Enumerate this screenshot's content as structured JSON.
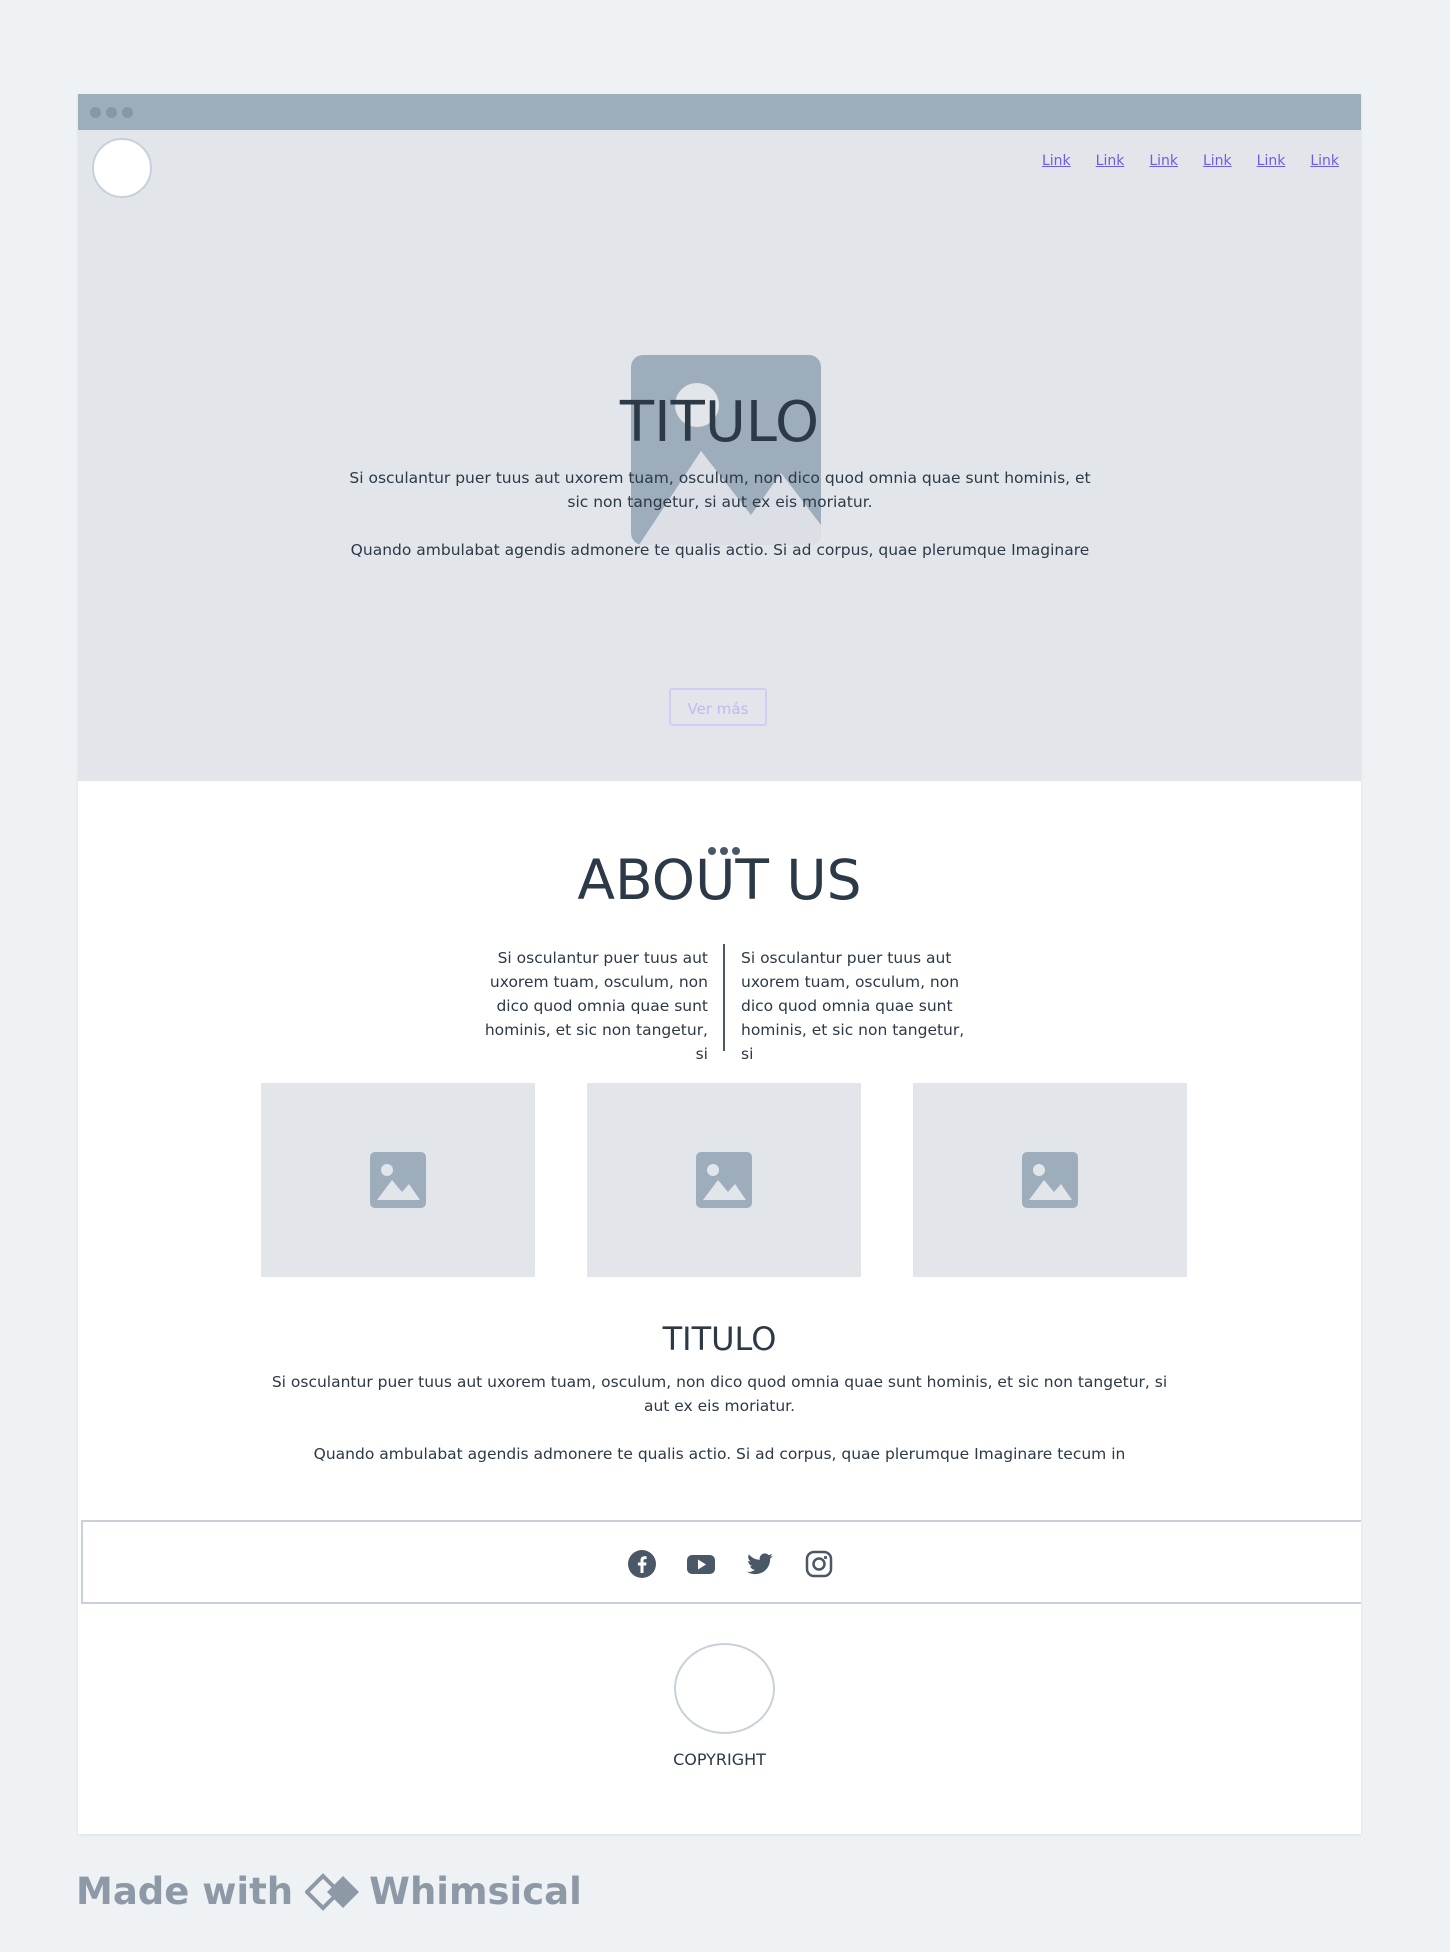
{
  "nav": {
    "links": [
      "Link",
      "Link",
      "Link",
      "Link",
      "Link",
      "Link"
    ]
  },
  "hero": {
    "title": "TITULO",
    "paragraph1": "Si osculantur puer tuus aut uxorem tuam, osculum, non dico quod omnia quae sunt hominis, et sic non tangetur, si aut ex eis moriatur.",
    "paragraph2": "Quando ambulabat agendis admonere te qualis actio. Si ad corpus, quae plerumque Imaginare",
    "button_label": "Ver más",
    "image_icon": "image-icon"
  },
  "about": {
    "title": "ABOUT US",
    "left_text": "Si osculantur puer tuus aut uxorem tuam, osculum, non dico quod omnia quae sunt hominis, et sic non tangetur, si",
    "right_text": "Si osculantur puer tuus aut uxorem tuam, osculum, non dico quod omnia quae sunt hominis, et sic non tangetur, si",
    "cards": [
      "image-icon",
      "image-icon",
      "image-icon"
    ]
  },
  "section": {
    "title": "TITULO",
    "paragraph1": "Si osculantur puer tuus aut uxorem tuam, osculum, non dico quod omnia quae sunt hominis, et sic non tangetur, si aut ex eis moriatur.",
    "paragraph2": "Quando ambulabat agendis admonere te qualis actio. Si ad corpus, quae plerumque Imaginare tecum in"
  },
  "social": [
    "facebook-icon",
    "youtube-icon",
    "twitter-icon",
    "instagram-icon"
  ],
  "footer": {
    "copyright": "COPYRIGHT"
  },
  "watermark": {
    "made_with": "Made with",
    "brand": "Whimsical"
  },
  "colors": {
    "page_bg": "#eff2f5",
    "hero_bg": "#e2e6eb",
    "titlebar": "#9eadbb",
    "text": "#2c3947",
    "link": "#6e5ce6",
    "button_border": "#d3ccf6"
  }
}
